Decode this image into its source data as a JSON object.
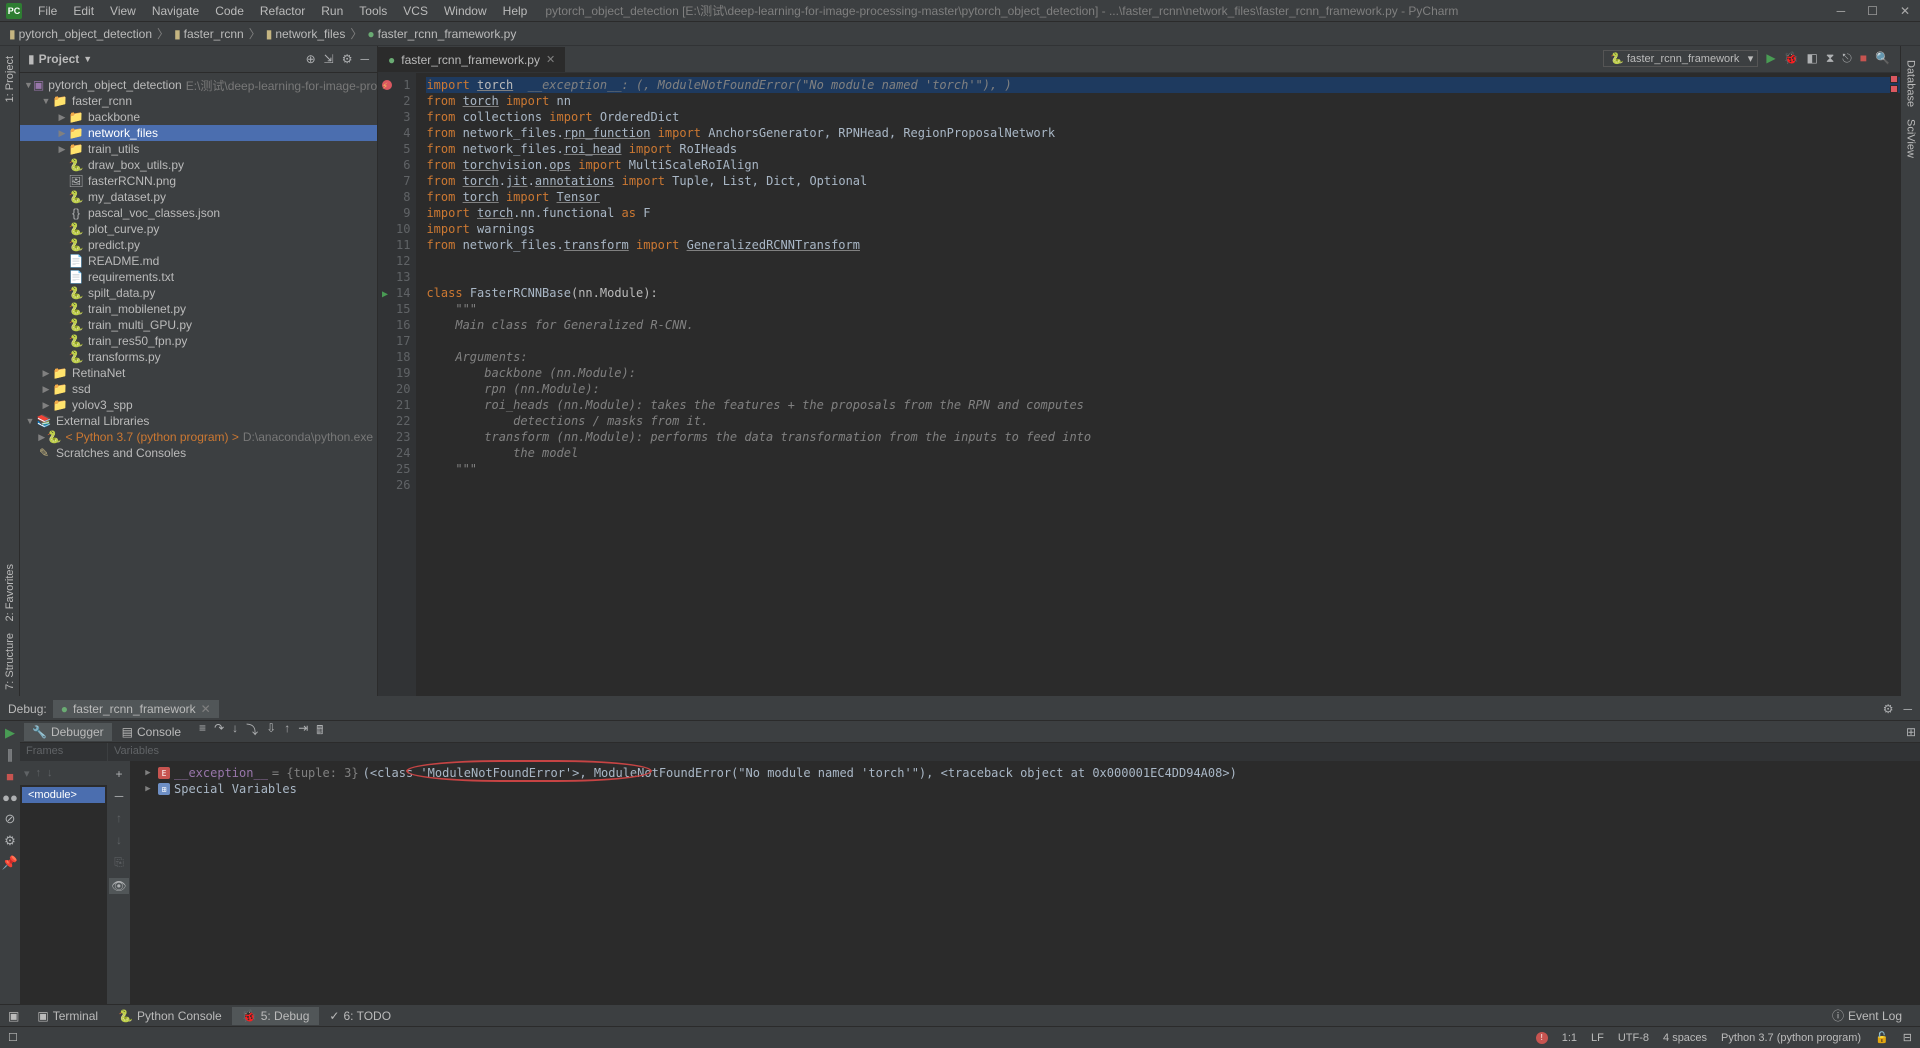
{
  "window": {
    "title": "pytorch_object_detection [E:\\测试\\deep-learning-for-image-processing-master\\pytorch_object_detection] - ...\\faster_rcnn\\network_files\\faster_rcnn_framework.py - PyCharm"
  },
  "menu": [
    "File",
    "Edit",
    "View",
    "Navigate",
    "Code",
    "Refactor",
    "Run",
    "Tools",
    "VCS",
    "Window",
    "Help"
  ],
  "breadcrumb": {
    "root": "pytorch_object_detection",
    "p1": "faster_rcnn",
    "p2": "network_files",
    "p3": "faster_rcnn_framework.py"
  },
  "run_config": "faster_rcnn_framework",
  "project": {
    "title": "Project",
    "root": "pytorch_object_detection",
    "root_aux": "E:\\测试\\deep-learning-for-image-processing-m",
    "items": [
      {
        "indent": 1,
        "arrow": "▼",
        "icon": "📁",
        "label": "faster_rcnn",
        "cls": "folder"
      },
      {
        "indent": 2,
        "arrow": "▶",
        "icon": "📁",
        "label": "backbone",
        "cls": "folder"
      },
      {
        "indent": 2,
        "arrow": "▶",
        "icon": "📁",
        "label": "network_files",
        "cls": "folder",
        "selected": true
      },
      {
        "indent": 2,
        "arrow": "▶",
        "icon": "📁",
        "label": "train_utils",
        "cls": "folder"
      },
      {
        "indent": 2,
        "arrow": "",
        "icon": "🐍",
        "label": "draw_box_utils.py",
        "cls": "pyfile"
      },
      {
        "indent": 2,
        "arrow": "",
        "icon": "🖼",
        "label": "fasterRCNN.png",
        "cls": "file"
      },
      {
        "indent": 2,
        "arrow": "",
        "icon": "🐍",
        "label": "my_dataset.py",
        "cls": "pyfile"
      },
      {
        "indent": 2,
        "arrow": "",
        "icon": "{}",
        "label": "pascal_voc_classes.json",
        "cls": "file"
      },
      {
        "indent": 2,
        "arrow": "",
        "icon": "🐍",
        "label": "plot_curve.py",
        "cls": "pyfile"
      },
      {
        "indent": 2,
        "arrow": "",
        "icon": "🐍",
        "label": "predict.py",
        "cls": "pyfile"
      },
      {
        "indent": 2,
        "arrow": "",
        "icon": "📄",
        "label": "README.md",
        "cls": "file"
      },
      {
        "indent": 2,
        "arrow": "",
        "icon": "📄",
        "label": "requirements.txt",
        "cls": "file"
      },
      {
        "indent": 2,
        "arrow": "",
        "icon": "🐍",
        "label": "spilt_data.py",
        "cls": "pyfile"
      },
      {
        "indent": 2,
        "arrow": "",
        "icon": "🐍",
        "label": "train_mobilenet.py",
        "cls": "pyfile"
      },
      {
        "indent": 2,
        "arrow": "",
        "icon": "🐍",
        "label": "train_multi_GPU.py",
        "cls": "pyfile"
      },
      {
        "indent": 2,
        "arrow": "",
        "icon": "🐍",
        "label": "train_res50_fpn.py",
        "cls": "pyfile"
      },
      {
        "indent": 2,
        "arrow": "",
        "icon": "🐍",
        "label": "transforms.py",
        "cls": "pyfile"
      },
      {
        "indent": 1,
        "arrow": "▶",
        "icon": "📁",
        "label": "RetinaNet",
        "cls": "folder"
      },
      {
        "indent": 1,
        "arrow": "▶",
        "icon": "📁",
        "label": "ssd",
        "cls": "folder"
      },
      {
        "indent": 1,
        "arrow": "▶",
        "icon": "📁",
        "label": "yolov3_spp",
        "cls": "folder"
      }
    ],
    "ext_lib": "External Libraries",
    "python": "< Python 3.7 (python program) >",
    "python_aux": "D:\\anaconda\\python.exe",
    "scratches": "Scratches and Consoles"
  },
  "left_tabs": {
    "project": "1: Project",
    "favorites": "2: Favorites",
    "structure": "7: Structure"
  },
  "right_tabs": {
    "database": "Database",
    "sciview": "SciView"
  },
  "editor": {
    "tab_label": "faster_rcnn_framework.py",
    "inline_exc": "  __exception__: (<class 'ModuleNotFoundError'>, ModuleNotFoundError(\"No module named 'torch'\"), <traceback object at 0x000001EC4DD94A08>)",
    "lines": [
      "import torch",
      "from torch import nn",
      "from collections import OrderedDict",
      "from network_files.rpn_function import AnchorsGenerator, RPNHead, RegionProposalNetwork",
      "from network_files.roi_head import RoIHeads",
      "from torchvision.ops import MultiScaleRoIAlign",
      "from torch.jit.annotations import Tuple, List, Dict, Optional",
      "from torch import Tensor",
      "import torch.nn.functional as F",
      "import warnings",
      "from network_files.transform import GeneralizedRCNNTransform",
      "",
      "",
      "class FasterRCNNBase(nn.Module):",
      "    \"\"\"",
      "    Main class for Generalized R-CNN.",
      "",
      "    Arguments:",
      "        backbone (nn.Module):",
      "        rpn (nn.Module):",
      "        roi_heads (nn.Module): takes the features + the proposals from the RPN and computes",
      "            detections / masks from it.",
      "        transform (nn.Module): performs the data transformation from the inputs to feed into",
      "            the model",
      "    \"\"\"",
      ""
    ]
  },
  "debug": {
    "title": "Debug:",
    "tab": "faster_rcnn_framework",
    "debugger_tab": "Debugger",
    "console_tab": "Console",
    "frames_label": "Frames",
    "vars_label": "Variables",
    "frame": "<module>",
    "var_add": "+",
    "exception_name": "__exception__",
    "exception_type": "= {tuple: 3}",
    "exception_val": "(<class 'ModuleNotFoundError'>, ModuleNotFoundError(\"No module named 'torch'\"), <traceback object at 0x000001EC4DD94A08>)",
    "exception_mid": "ModuleNotFoundError(\"No module named 'torch'\"),",
    "special_vars": "Special Variables"
  },
  "bottom_tabs": {
    "terminal": "Terminal",
    "pyconsole": "Python Console",
    "debug": "5: Debug",
    "todo": "6: TODO",
    "eventlog": "Event Log"
  },
  "status": {
    "pos": "1:1",
    "le": "LF",
    "enc": "UTF-8",
    "indent": "4 spaces",
    "interp": "Python 3.7 (python program)"
  }
}
